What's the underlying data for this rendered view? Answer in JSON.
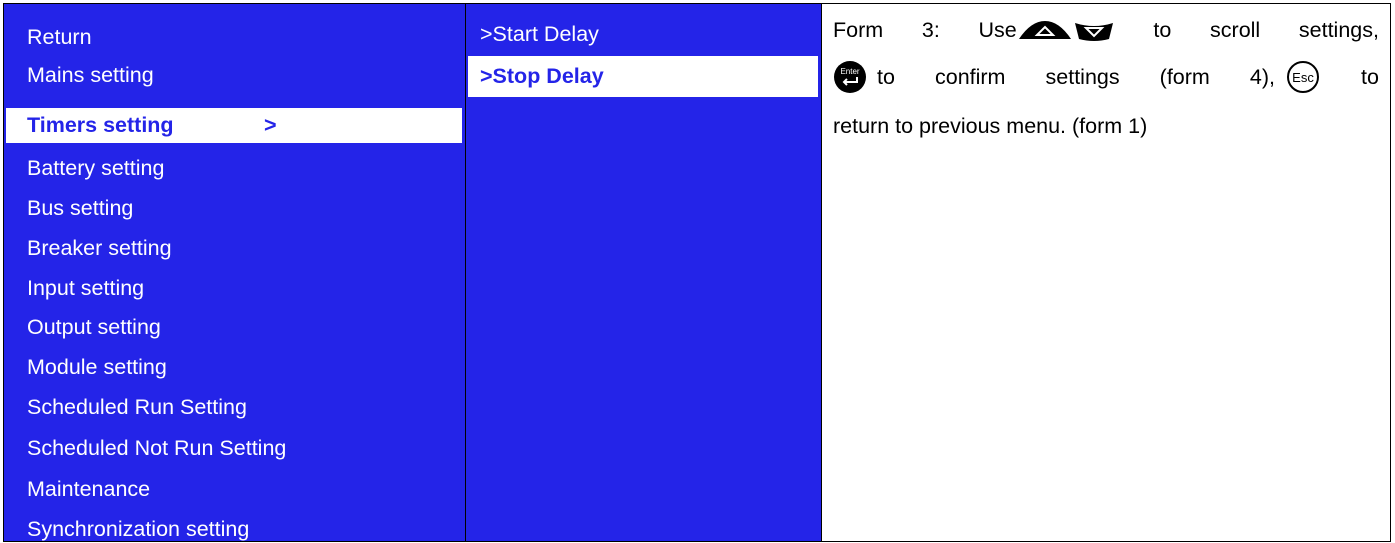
{
  "main_menu": {
    "items": [
      {
        "label": "Return"
      },
      {
        "label": "Mains setting"
      },
      {
        "label": "Timers setting",
        "arrow": ">"
      },
      {
        "label": "Battery setting"
      },
      {
        "label": "Bus setting"
      },
      {
        "label": "Breaker setting"
      },
      {
        "label": "Input setting"
      },
      {
        "label": "Output setting"
      },
      {
        "label": "Module setting"
      },
      {
        "label": "Scheduled Run Setting"
      },
      {
        "label": "Scheduled Not Run Setting"
      },
      {
        "label": "Maintenance"
      },
      {
        "label": "Synchronization setting"
      }
    ],
    "selected_index": 2
  },
  "sub_menu": {
    "items": [
      {
        "label": ">Start Delay"
      },
      {
        "label": ">Stop Delay"
      }
    ],
    "selected_index": 1
  },
  "help": {
    "line1_a": "Form",
    "line1_b": "3:",
    "line1_c": "Use",
    "line1_d": "to",
    "line1_e": "scroll",
    "line1_f": "settings,",
    "line2_a": "to",
    "line2_b": "confirm",
    "line2_c": "settings",
    "line2_d": "(form",
    "line2_e": "4),",
    "line2_f": "to",
    "line3": "return to previous menu. (form 1)",
    "icons": [
      "up-arrow-icon",
      "down-arrow-icon",
      "enter-key-icon",
      "esc-key-icon"
    ],
    "enter_icon_text": "Enter",
    "esc_icon_text": "Esc"
  },
  "colors": {
    "menu_bg": "#2424e8",
    "selected_bg": "#ffffff",
    "selected_text": "#2424e8",
    "text": "#ffffff"
  }
}
